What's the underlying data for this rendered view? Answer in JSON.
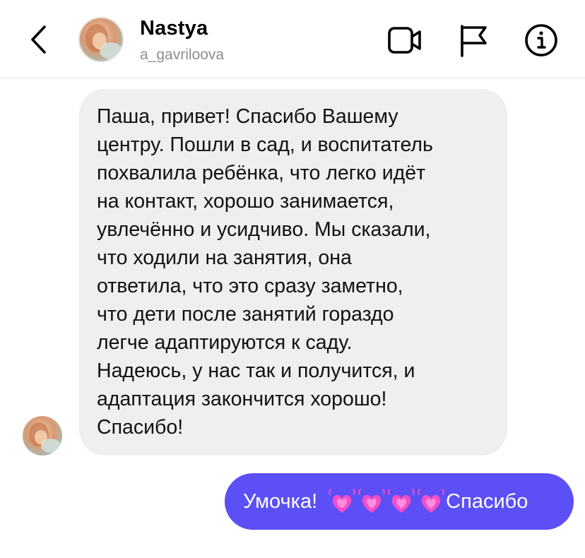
{
  "header": {
    "contact_name": "Nastya",
    "contact_username": "a_gavriloova",
    "icons": [
      "back-chevron-icon",
      "video-call-icon",
      "report-flag-icon",
      "info-icon"
    ]
  },
  "messages": {
    "incoming": {
      "text": "Паша, привет! Спасибо Вашему\nцентру. Пошли в сад, и воспитатель\nпохвалила ребёнка, что легко идёт\nна контакт, хорошо занимается,\nувлечённо и усидчиво. Мы сказали,\nчто ходили на занятия, она\nответила, что это сразу заметно,\nчто дети после занятий гораздо\nлегче адаптируются к саду.\nНадеюсь, у нас так и получится, и\nадаптация закончится хорошо!\nСпасибо!"
    },
    "outgoing": {
      "text_before": "Умочка!",
      "emoji": [
        "💓",
        "💓",
        "💓",
        "💓"
      ],
      "text_after": "Спасибо"
    }
  },
  "colors": {
    "incoming_bubble": "#efefef",
    "outgoing_bubble": "#5b4ff5",
    "username_gray": "#8e8e8e",
    "heart_pink": "#f24ec8"
  }
}
